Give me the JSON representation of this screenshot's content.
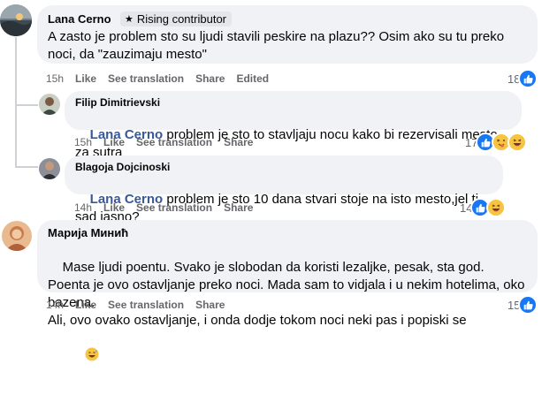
{
  "actions": {
    "like": "Like",
    "see_translation": "See translation",
    "share": "Share",
    "edited": "Edited"
  },
  "comments": [
    {
      "author": "Lana Cerno",
      "badge": "Rising contributor",
      "text": "A zasto je problem sto su ljudi stavili peskire na plazu?? Osim ako su tu preko noci, da \"zauzimaju mesto\"",
      "time": "15h",
      "edited": true,
      "reaction_count": "18",
      "reactions": [
        "like"
      ]
    },
    {
      "author": "Filip Dimitrievski",
      "mention": "Lana Cerno",
      "text": " problem je sto to stavljaju nocu kako bi rezervisali mesto za sutra",
      "time": "15h",
      "reaction_count": "17",
      "reactions": [
        "like",
        "haha-tongue",
        "haha"
      ]
    },
    {
      "author": "Blagoja Dojcinoski",
      "mention": "Lana Cerno",
      "text": " problem je sto 10 dana stvari stoje na isto mesto,jel ti sad jasno?",
      "time": "14h",
      "reaction_count": "14",
      "reactions": [
        "like",
        "haha"
      ]
    },
    {
      "author": "Марија Минић",
      "text": "Mase ljudi poentu. Svako je slobodan da koristi lezaljke, pesak, sta god. Poenta je ovo ostavljanje preko noci. Mada sam to vidjala i u nekim hotelima, oko bazena.\nAli, ovo ovako ostavljanje, i onda dodje tokom noci neki pas i popiski se",
      "time": "14h",
      "reaction_count": "15",
      "reactions": [
        "like"
      ]
    }
  ],
  "colors": {
    "like_blue": "#1877f2",
    "bubble_bg": "#f0f2f5",
    "meta_text": "#65676b",
    "mention": "#385898"
  }
}
